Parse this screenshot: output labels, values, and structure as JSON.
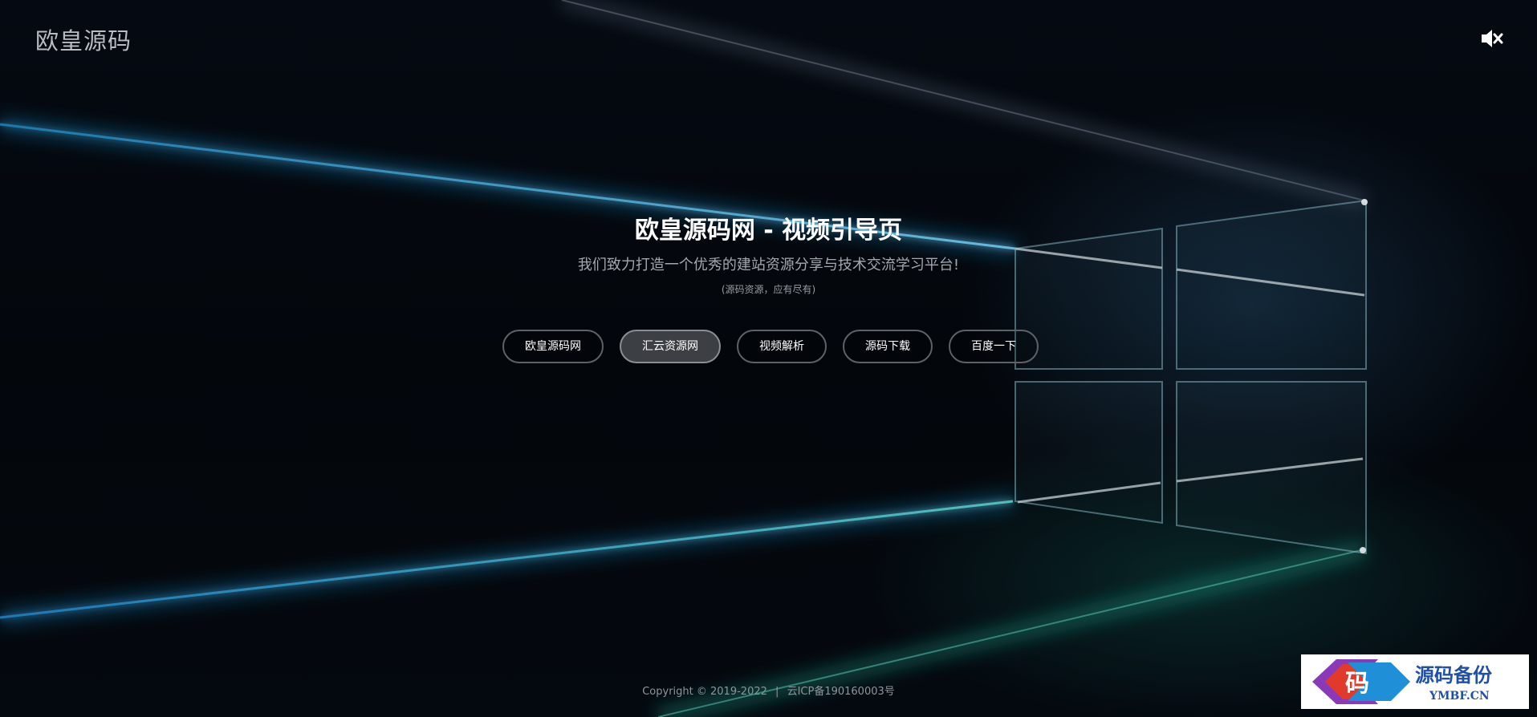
{
  "header": {
    "brand": "欧皇源码",
    "mute_icon": "speaker-muted-icon"
  },
  "hero": {
    "title": "欧皇源码网 - 视频引导页",
    "subtitle": "我们致力打造一个优秀的建站资源分享与技术交流学习平台!",
    "note": "(源码资源，应有尽有)"
  },
  "nav": {
    "buttons": [
      {
        "label": "欧皇源码网",
        "active": false
      },
      {
        "label": "汇云资源网",
        "active": true
      },
      {
        "label": "视频解析",
        "active": false
      },
      {
        "label": "源码下载",
        "active": false
      },
      {
        "label": "百度一下",
        "active": false
      }
    ]
  },
  "footer": {
    "copyright": "Copyright  ©  2019-2022",
    "separator": "|",
    "icp": "云ICP备190160003号"
  },
  "watermark": {
    "glyph": "码",
    "title": "源码备份",
    "domain": "YMBF.CN"
  },
  "colors": {
    "light_beam": "#2aa8d8",
    "glow_teal": "#1fb39a",
    "watermark_blue": "#1f4fa8",
    "watermark_red": "#e23a2a",
    "watermark_purple": "#8a3ab8"
  }
}
